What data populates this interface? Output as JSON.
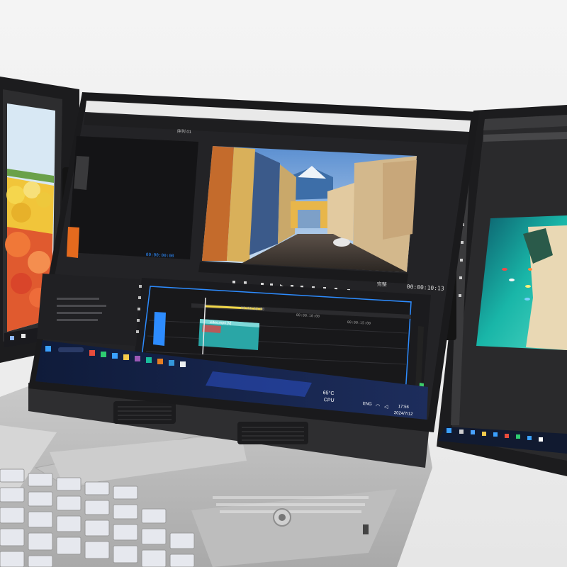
{
  "premiere": {
    "program_timecode": "00:00:10:13",
    "source_timecode": "00:00:00:00",
    "fit_label": "完整",
    "ruler_marks": [
      "00:00:05:00",
      "00:00:10:00",
      "00:00:15:00"
    ],
    "sequence_label": "序列 01",
    "clip_label": "video.mp4 [V]"
  },
  "taskbar": {
    "cpu_temp": "65°C",
    "cpu_label": "CPU",
    "lang": "ENG",
    "time": "17:56",
    "date": "2024/7/12"
  },
  "colors": {
    "accent_blue": "#2d8cff",
    "timeline_clip": "#2aa6a6",
    "playhead": "#e8e8e8",
    "audio_meter": "#3ecf6b"
  },
  "icons": [
    "windows-start-icon",
    "search-icon",
    "play-icon",
    "camera-icon",
    "share-icon",
    "wifi-icon",
    "volume-icon",
    "battery-icon"
  ]
}
